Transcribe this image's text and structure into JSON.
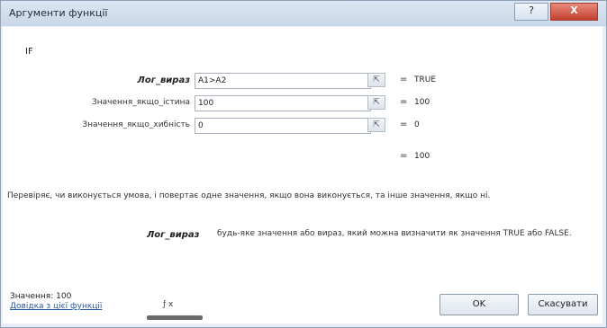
{
  "window": {
    "title": "Аргументи функції",
    "help_btn": "?",
    "close_btn": "X"
  },
  "function_name": "IF",
  "args": [
    {
      "label": "Лог_вираз",
      "value": "A1>A2",
      "result": "TRUE",
      "bold": true
    },
    {
      "label": "Значення_якщо_істина",
      "value": "100",
      "result": "100",
      "bold": false
    },
    {
      "label": "Значення_якщо_хибність",
      "value": "0",
      "result": "0",
      "bold": false
    }
  ],
  "result_eq": "=",
  "total_result": "100",
  "description": "Перевіряє, чи виконується умова, і повертає одне значення, якщо вона виконується, та інше значення, якщо ні.",
  "detail": {
    "name": "Лог_вираз",
    "text": "будь-яке значення або вираз, який можна визначити як значення TRUE або FALSE."
  },
  "value_label": "Значення:",
  "value": "100",
  "help_link": "Довідка з цієї функції",
  "ok_label": "OK",
  "cancel_label": "Скасувати",
  "scroll_label": "ƒ x"
}
